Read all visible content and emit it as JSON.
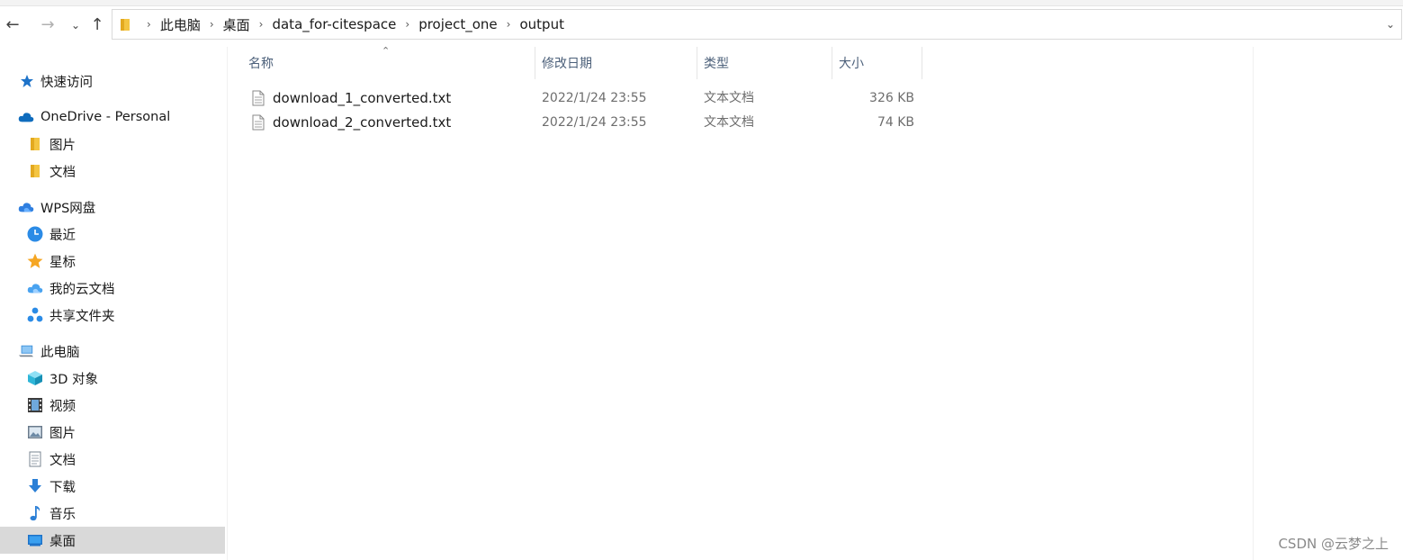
{
  "nav": {
    "back_icon": "arrow-left-icon",
    "forward_icon": "arrow-right-icon",
    "recent_icon": "chevron-down-icon",
    "up_icon": "arrow-up-icon"
  },
  "address": {
    "crumbs": [
      "此电脑",
      "桌面",
      "data_for-citespace",
      "project_one",
      "output"
    ]
  },
  "sidebar": {
    "items": [
      {
        "label": "快速访问",
        "icon": "star-icon"
      },
      {
        "label": "OneDrive - Personal",
        "icon": "cloud-icon"
      },
      {
        "label": "图片",
        "icon": "folder-icon"
      },
      {
        "label": "文档",
        "icon": "folder-icon"
      },
      {
        "label": "WPS网盘",
        "icon": "cloud-icon"
      },
      {
        "label": "最近",
        "icon": "clock-icon"
      },
      {
        "label": "星标",
        "icon": "star-icon"
      },
      {
        "label": "我的云文档",
        "icon": "cloud-icon"
      },
      {
        "label": "共享文件夹",
        "icon": "share-icon"
      },
      {
        "label": "此电脑",
        "icon": "computer-icon"
      },
      {
        "label": "3D 对象",
        "icon": "cube-icon"
      },
      {
        "label": "视频",
        "icon": "film-icon"
      },
      {
        "label": "图片",
        "icon": "picture-icon"
      },
      {
        "label": "文档",
        "icon": "document-icon"
      },
      {
        "label": "下载",
        "icon": "download-icon"
      },
      {
        "label": "音乐",
        "icon": "music-icon"
      },
      {
        "label": "桌面",
        "icon": "desktop-icon"
      }
    ]
  },
  "columns": {
    "name": "名称",
    "date": "修改日期",
    "type": "类型",
    "size": "大小"
  },
  "files": [
    {
      "name": "download_1_converted.txt",
      "date": "2022/1/24 23:55",
      "type": "文本文档",
      "size": "326 KB"
    },
    {
      "name": "download_2_converted.txt",
      "date": "2022/1/24 23:55",
      "type": "文本文档",
      "size": "74 KB"
    }
  ],
  "watermark": "CSDN @云梦之上",
  "colors": {
    "accent": "#0078d4",
    "folder": "#f4c542",
    "selected": "#d9d9d9"
  }
}
